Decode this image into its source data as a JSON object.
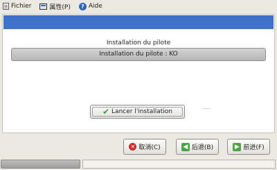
{
  "menubar": {
    "items": [
      {
        "label": "Fichier",
        "icon": "file-icon"
      },
      {
        "label": "属性(P)",
        "icon": "properties-icon"
      },
      {
        "label": "Aide",
        "icon": "help-icon"
      }
    ]
  },
  "main": {
    "title": "Installation du pilote",
    "progress_text": "Installation du pilote : KO",
    "launch_label": "Lancer l'installation"
  },
  "buttons": {
    "cancel_label": "取消(C)",
    "back_label": "后退(B)",
    "next_label": "前进(F)"
  },
  "colors": {
    "header_strip": "#3f72c8",
    "check": "#35a33a",
    "cancel": "#d22a2a",
    "nav_arrow": "#49a542"
  }
}
